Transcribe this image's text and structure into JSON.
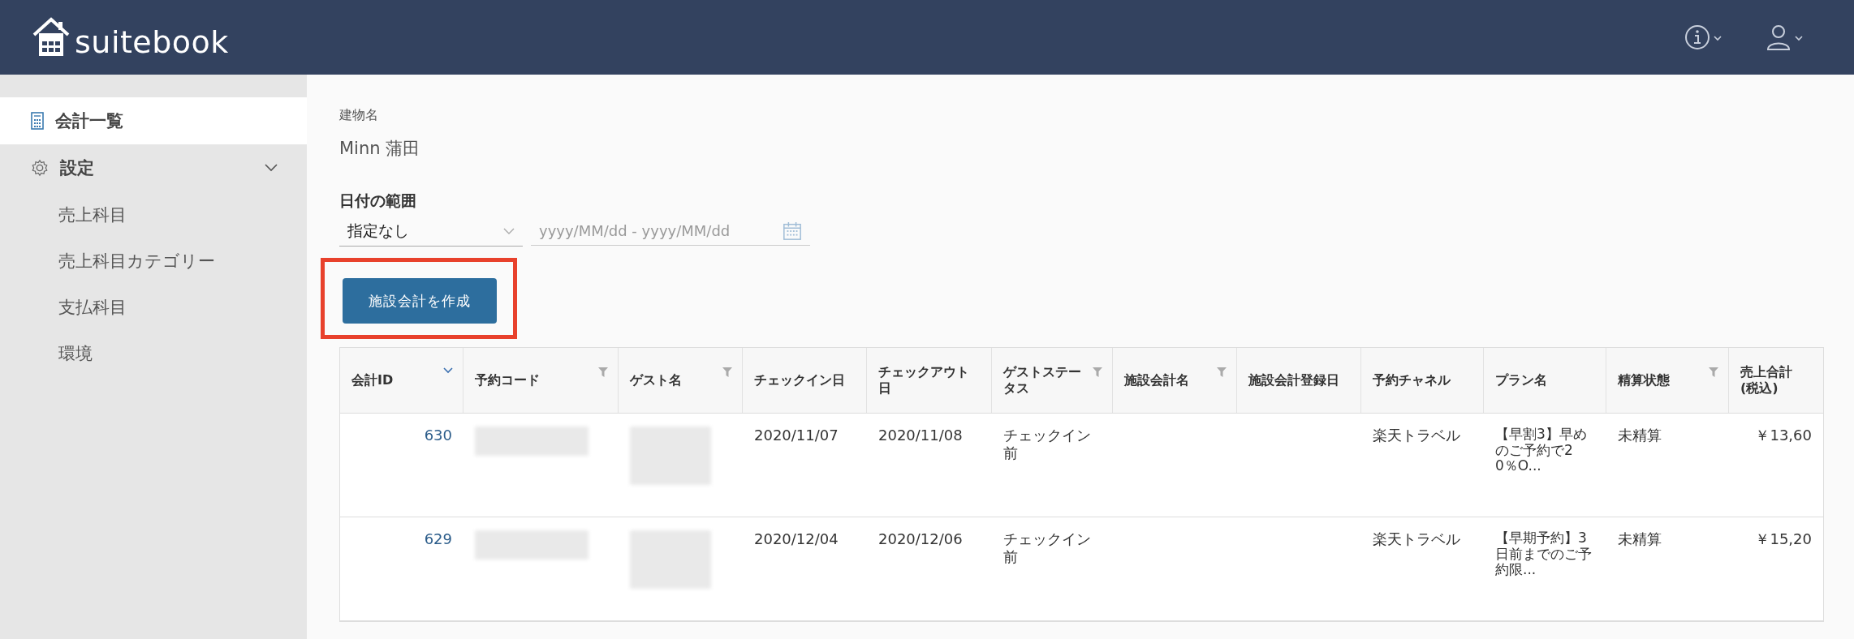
{
  "header": {
    "logo": "suitebook"
  },
  "sidebar": {
    "items": [
      {
        "label": "会計一覧",
        "kind": "top",
        "selected": true
      },
      {
        "label": "設定",
        "kind": "top",
        "selected": false,
        "expanded": true,
        "children": [
          {
            "label": "売上科目",
            "selected": false
          },
          {
            "label": "売上科目カテゴリー",
            "selected": false
          },
          {
            "label": "支払科目",
            "selected": false
          },
          {
            "label": "環境",
            "selected": false
          }
        ]
      }
    ]
  },
  "building": {
    "label": "建物名",
    "value": "Minn 蒲田"
  },
  "date_range": {
    "label": "日付の範囲",
    "select_value": "指定なし",
    "placeholder": "yyyy/MM/dd - yyyy/MM/dd"
  },
  "create_button": {
    "label": "施設会計を作成",
    "highlighted": true
  },
  "table": {
    "columns": [
      {
        "label": "会計ID",
        "kind": "sort"
      },
      {
        "label": "予約コード",
        "kind": "filter"
      },
      {
        "label": "ゲスト名",
        "kind": "filter"
      },
      {
        "label": "チェックイン日",
        "kind": "plain"
      },
      {
        "label": "チェックアウト日",
        "kind": "plain"
      },
      {
        "label": "ゲストステータス",
        "kind": "filter"
      },
      {
        "label": "施設会計名",
        "kind": "filter"
      },
      {
        "label": "施設会計登録日",
        "kind": "plain"
      },
      {
        "label": "予約チャネル",
        "kind": "plain"
      },
      {
        "label": "プラン名",
        "kind": "plain"
      },
      {
        "label": "精算状態",
        "kind": "filter"
      },
      {
        "label": "売上合計 (税込)",
        "kind": "plain"
      }
    ],
    "rows": [
      {
        "id": "630",
        "checkin": "2020/11/07",
        "checkout": "2020/11/08",
        "status": "チェックイン前",
        "channel": "楽天トラベル",
        "plan": "【早割3】早めのご予約で20％O...",
        "settlement": "未精算",
        "total": "￥13,60"
      },
      {
        "id": "629",
        "checkin": "2020/12/04",
        "checkout": "2020/12/06",
        "status": "チェックイン前",
        "channel": "楽天トラベル",
        "plan": "【早期予約】3日前までのご予約限...",
        "settlement": "未精算",
        "total": "￥15,20"
      }
    ]
  }
}
